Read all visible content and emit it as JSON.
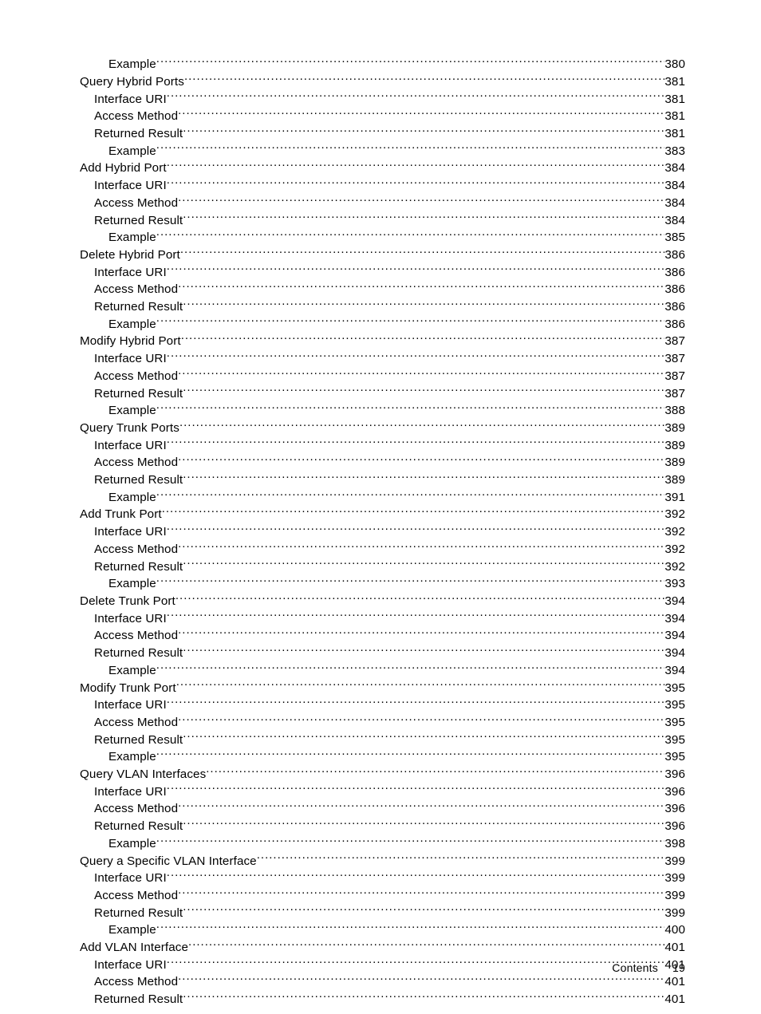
{
  "toc": [
    {
      "label": "Example",
      "page": "380",
      "indent": 2
    },
    {
      "label": "Query Hybrid Ports",
      "page": "381",
      "indent": 0
    },
    {
      "label": "Interface URI",
      "page": "381",
      "indent": 1
    },
    {
      "label": "Access Method",
      "page": "381",
      "indent": 1
    },
    {
      "label": "Returned Result",
      "page": "381",
      "indent": 1
    },
    {
      "label": "Example",
      "page": "383",
      "indent": 2
    },
    {
      "label": "Add Hybrid Port",
      "page": "384",
      "indent": 0
    },
    {
      "label": "Interface URI",
      "page": "384",
      "indent": 1
    },
    {
      "label": "Access Method",
      "page": "384",
      "indent": 1
    },
    {
      "label": "Returned Result",
      "page": "384",
      "indent": 1
    },
    {
      "label": "Example",
      "page": "385",
      "indent": 2
    },
    {
      "label": "Delete Hybrid Port",
      "page": "386",
      "indent": 0
    },
    {
      "label": "Interface URI",
      "page": "386",
      "indent": 1
    },
    {
      "label": "Access Method",
      "page": "386",
      "indent": 1
    },
    {
      "label": "Returned Result",
      "page": "386",
      "indent": 1
    },
    {
      "label": "Example",
      "page": "386",
      "indent": 2
    },
    {
      "label": "Modify Hybrid Port",
      "page": "387",
      "indent": 0
    },
    {
      "label": "Interface URI",
      "page": "387",
      "indent": 1
    },
    {
      "label": "Access Method",
      "page": "387",
      "indent": 1
    },
    {
      "label": "Returned Result",
      "page": "387",
      "indent": 1
    },
    {
      "label": "Example",
      "page": "388",
      "indent": 2
    },
    {
      "label": "Query Trunk Ports",
      "page": "389",
      "indent": 0
    },
    {
      "label": "Interface URI",
      "page": "389",
      "indent": 1
    },
    {
      "label": "Access Method",
      "page": "389",
      "indent": 1
    },
    {
      "label": "Returned Result",
      "page": "389",
      "indent": 1
    },
    {
      "label": "Example",
      "page": "391",
      "indent": 2
    },
    {
      "label": "Add Trunk Port",
      "page": "392",
      "indent": 0
    },
    {
      "label": "Interface URI",
      "page": "392",
      "indent": 1
    },
    {
      "label": "Access Method",
      "page": "392",
      "indent": 1
    },
    {
      "label": "Returned Result",
      "page": "392",
      "indent": 1
    },
    {
      "label": "Example",
      "page": "393",
      "indent": 2
    },
    {
      "label": "Delete Trunk Port",
      "page": "394",
      "indent": 0
    },
    {
      "label": "Interface URI",
      "page": "394",
      "indent": 1
    },
    {
      "label": "Access Method",
      "page": "394",
      "indent": 1
    },
    {
      "label": "Returned Result",
      "page": "394",
      "indent": 1
    },
    {
      "label": "Example",
      "page": "394",
      "indent": 2
    },
    {
      "label": "Modify Trunk Port",
      "page": "395",
      "indent": 0
    },
    {
      "label": "Interface URI",
      "page": "395",
      "indent": 1
    },
    {
      "label": "Access Method",
      "page": "395",
      "indent": 1
    },
    {
      "label": "Returned Result",
      "page": "395",
      "indent": 1
    },
    {
      "label": "Example",
      "page": "395",
      "indent": 2
    },
    {
      "label": "Query VLAN Interfaces",
      "page": "396",
      "indent": 0
    },
    {
      "label": "Interface URI",
      "page": "396",
      "indent": 1
    },
    {
      "label": "Access Method",
      "page": "396",
      "indent": 1
    },
    {
      "label": "Returned Result",
      "page": "396",
      "indent": 1
    },
    {
      "label": "Example",
      "page": "398",
      "indent": 2
    },
    {
      "label": "Query a Specific VLAN Interface ",
      "page": "399",
      "indent": 0
    },
    {
      "label": "Interface URI",
      "page": "399",
      "indent": 1
    },
    {
      "label": "Access Method",
      "page": "399",
      "indent": 1
    },
    {
      "label": "Returned Result",
      "page": "399",
      "indent": 1
    },
    {
      "label": "Example",
      "page": "400",
      "indent": 2
    },
    {
      "label": "Add VLAN Interface",
      "page": "401",
      "indent": 0
    },
    {
      "label": "Interface URI",
      "page": "401",
      "indent": 1
    },
    {
      "label": "Access Method",
      "page": "401",
      "indent": 1
    },
    {
      "label": "Returned Result",
      "page": "401",
      "indent": 1
    }
  ],
  "footer": {
    "label": "Contents",
    "page": "19"
  }
}
